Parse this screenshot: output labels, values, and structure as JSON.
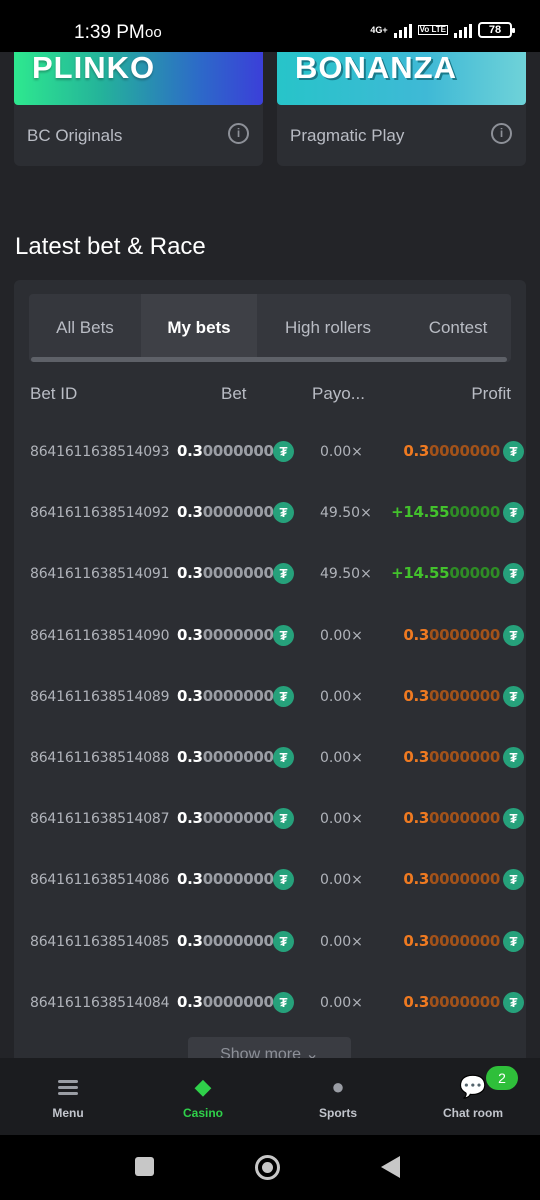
{
  "status_bar": {
    "time": "1:39 PM",
    "voicemail_icon": "voicemail-icon",
    "network": "4G+",
    "volte": "Vo LTE",
    "battery": "78"
  },
  "games": [
    {
      "banner_text": "PLINKO",
      "provider": "BC Originals"
    },
    {
      "banner_text": "BONANZA",
      "provider": "Pragmatic Play"
    }
  ],
  "section_title": "Latest bet & Race",
  "tabs": [
    {
      "label": "All Bets",
      "active": false
    },
    {
      "label": "My bets",
      "active": true
    },
    {
      "label": "High rollers",
      "active": false
    },
    {
      "label": "Contest",
      "active": false
    }
  ],
  "columns": {
    "bet_id": "Bet ID",
    "bet": "Bet",
    "payout": "Payo...",
    "profit": "Profit"
  },
  "rows": [
    {
      "id": "8641611638514093",
      "bet_main": "0.3",
      "bet_rest": "0000000",
      "payout": "0.00×",
      "profit_main": "0.3",
      "profit_rest": "0000000",
      "win": false
    },
    {
      "id": "8641611638514092",
      "bet_main": "0.3",
      "bet_rest": "0000000",
      "payout": "49.50×",
      "profit_main": "+14.55",
      "profit_rest": "00000",
      "win": true
    },
    {
      "id": "8641611638514091",
      "bet_main": "0.3",
      "bet_rest": "0000000",
      "payout": "49.50×",
      "profit_main": "+14.55",
      "profit_rest": "00000",
      "win": true
    },
    {
      "id": "8641611638514090",
      "bet_main": "0.3",
      "bet_rest": "0000000",
      "payout": "0.00×",
      "profit_main": "0.3",
      "profit_rest": "0000000",
      "win": false
    },
    {
      "id": "8641611638514089",
      "bet_main": "0.3",
      "bet_rest": "0000000",
      "payout": "0.00×",
      "profit_main": "0.3",
      "profit_rest": "0000000",
      "win": false
    },
    {
      "id": "8641611638514088",
      "bet_main": "0.3",
      "bet_rest": "0000000",
      "payout": "0.00×",
      "profit_main": "0.3",
      "profit_rest": "0000000",
      "win": false
    },
    {
      "id": "8641611638514087",
      "bet_main": "0.3",
      "bet_rest": "0000000",
      "payout": "0.00×",
      "profit_main": "0.3",
      "profit_rest": "0000000",
      "win": false
    },
    {
      "id": "8641611638514086",
      "bet_main": "0.3",
      "bet_rest": "0000000",
      "payout": "0.00×",
      "profit_main": "0.3",
      "profit_rest": "0000000",
      "win": false
    },
    {
      "id": "8641611638514085",
      "bet_main": "0.3",
      "bet_rest": "0000000",
      "payout": "0.00×",
      "profit_main": "0.3",
      "profit_rest": "0000000",
      "win": false
    },
    {
      "id": "8641611638514084",
      "bet_main": "0.3",
      "bet_rest": "0000000",
      "payout": "0.00×",
      "profit_main": "0.3",
      "profit_rest": "0000000",
      "win": false
    }
  ],
  "currency_icon": "tether-icon",
  "currency_glyph": "₮",
  "show_more": "Show more",
  "nav": [
    {
      "label": "Menu",
      "icon": "menu-icon",
      "active": false
    },
    {
      "label": "Casino",
      "icon": "casino-icon",
      "active": true
    },
    {
      "label": "Sports",
      "icon": "sports-ball-icon",
      "active": false
    },
    {
      "label": "Chat room",
      "icon": "chat-icon",
      "active": false,
      "badge": "2"
    }
  ],
  "colors": {
    "accent_green": "#2fd14a",
    "loss_orange": "#ef7a21",
    "win_green": "#43c22c",
    "tether": "#26a17b"
  }
}
